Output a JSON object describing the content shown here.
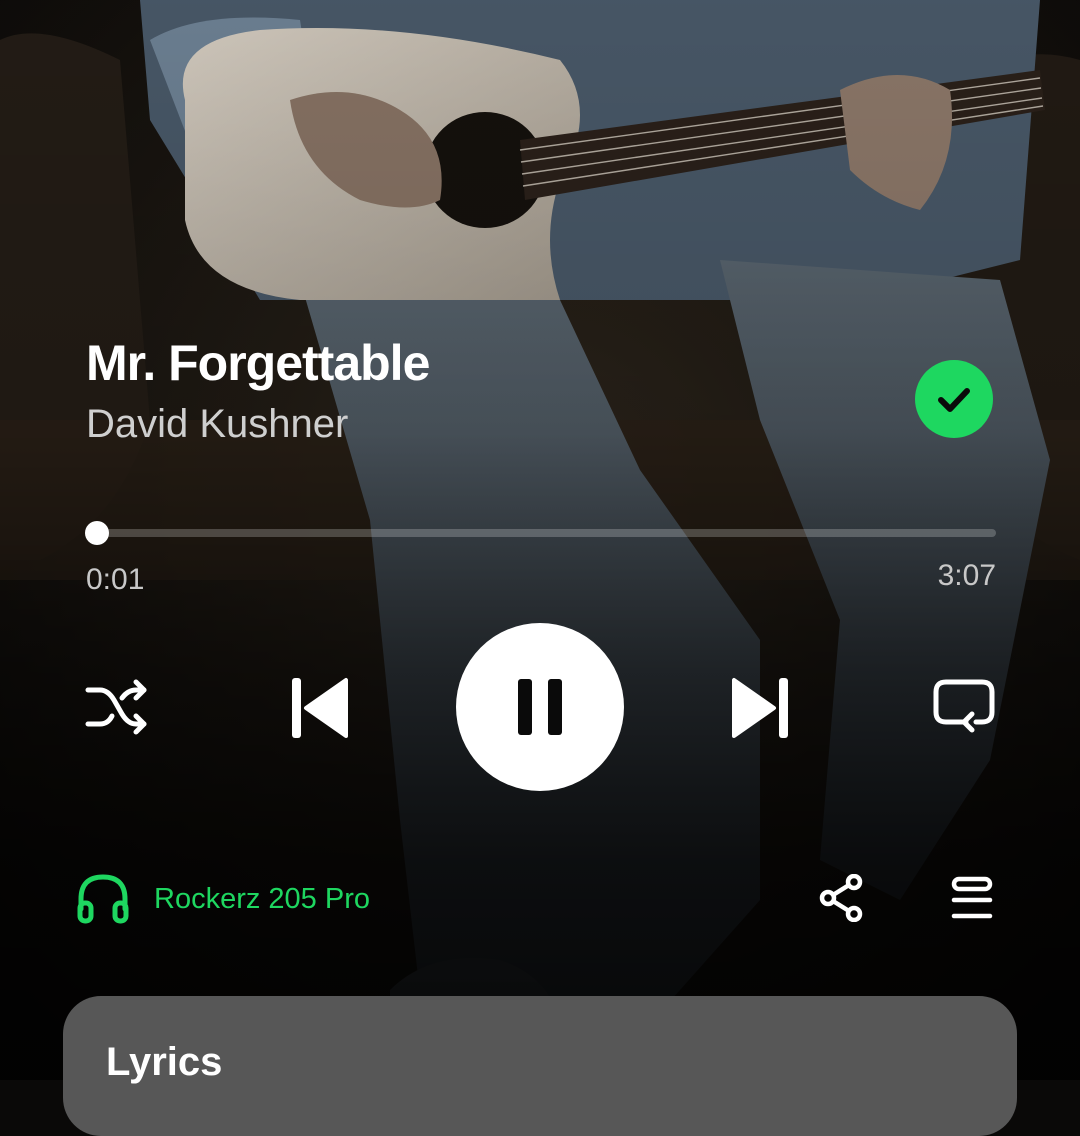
{
  "track": {
    "title": "Mr. Forgettable",
    "artist": "David Kushner",
    "saved": true,
    "artwork_icon": "guitarist-photo"
  },
  "playback": {
    "elapsed": "0:01",
    "duration": "3:07",
    "progress_fraction": 0.005,
    "state": "playing"
  },
  "controls": {
    "shuffle_icon": "shuffle-icon",
    "previous_icon": "skip-previous-icon",
    "play_pause_icon": "pause-icon",
    "next_icon": "skip-next-icon",
    "repeat_icon": "repeat-icon"
  },
  "device": {
    "name": "Rockerz 205 Pro",
    "icon": "headphones-icon"
  },
  "actions": {
    "share_icon": "share-icon",
    "queue_icon": "queue-icon"
  },
  "lyrics": {
    "title": "Lyrics"
  },
  "colors": {
    "accent": "#1ed760",
    "background": "#0a0908",
    "lyrics_card": "#575757"
  }
}
